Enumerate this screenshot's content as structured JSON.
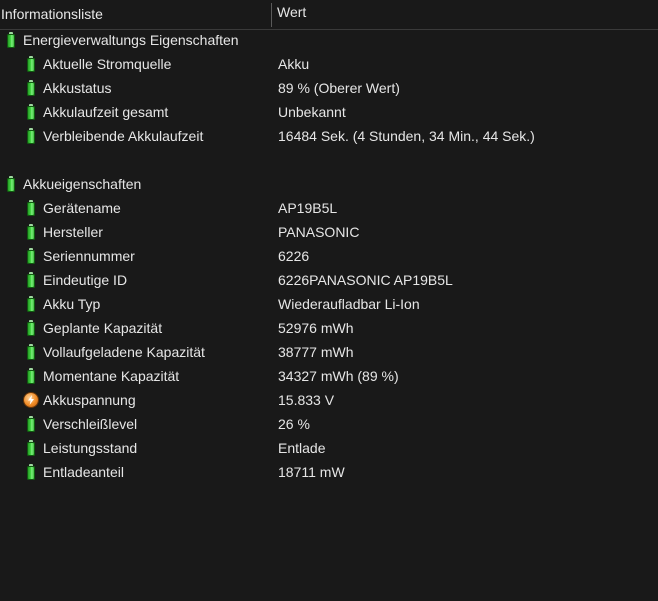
{
  "header": {
    "col_name": "Informationsliste",
    "col_value": "Wert"
  },
  "sections": [
    {
      "title": "Energieverwaltungs Eigenschaften",
      "icon": "battery-icon",
      "items": [
        {
          "label": "Aktuelle Stromquelle",
          "value": "Akku",
          "icon": "battery-icon"
        },
        {
          "label": "Akkustatus",
          "value": "89 % (Oberer Wert)",
          "icon": "battery-icon"
        },
        {
          "label": "Akkulaufzeit gesamt",
          "value": "Unbekannt",
          "icon": "battery-icon"
        },
        {
          "label": "Verbleibende Akkulaufzeit",
          "value": "16484 Sek. (4 Stunden, 34 Min., 44 Sek.)",
          "icon": "battery-icon"
        }
      ]
    },
    {
      "title": "Akkueigenschaften",
      "icon": "battery-icon",
      "items": [
        {
          "label": "Gerätename",
          "value": "AP19B5L",
          "icon": "battery-icon"
        },
        {
          "label": "Hersteller",
          "value": "PANASONIC",
          "icon": "battery-icon"
        },
        {
          "label": "Seriennummer",
          "value": "6226",
          "icon": "battery-icon"
        },
        {
          "label": "Eindeutige ID",
          "value": "6226PANASONIC AP19B5L",
          "icon": "battery-icon"
        },
        {
          "label": "Akku Typ",
          "value": "Wiederaufladbar Li-Ion",
          "icon": "battery-icon"
        },
        {
          "label": "Geplante Kapazität",
          "value": "52976 mWh",
          "icon": "battery-icon"
        },
        {
          "label": "Vollaufgeladene Kapazität",
          "value": "38777 mWh",
          "icon": "battery-icon"
        },
        {
          "label": "Momentane Kapazität",
          "value": "34327 mWh  (89 %)",
          "icon": "battery-icon"
        },
        {
          "label": "Akkuspannung",
          "value": "15.833 V",
          "icon": "voltage-icon"
        },
        {
          "label": "Verschleißlevel",
          "value": "26 %",
          "icon": "battery-icon"
        },
        {
          "label": "Leistungsstand",
          "value": "Entlade",
          "icon": "battery-icon"
        },
        {
          "label": "Entladeanteil",
          "value": "18711 mW",
          "icon": "battery-icon"
        }
      ]
    }
  ]
}
